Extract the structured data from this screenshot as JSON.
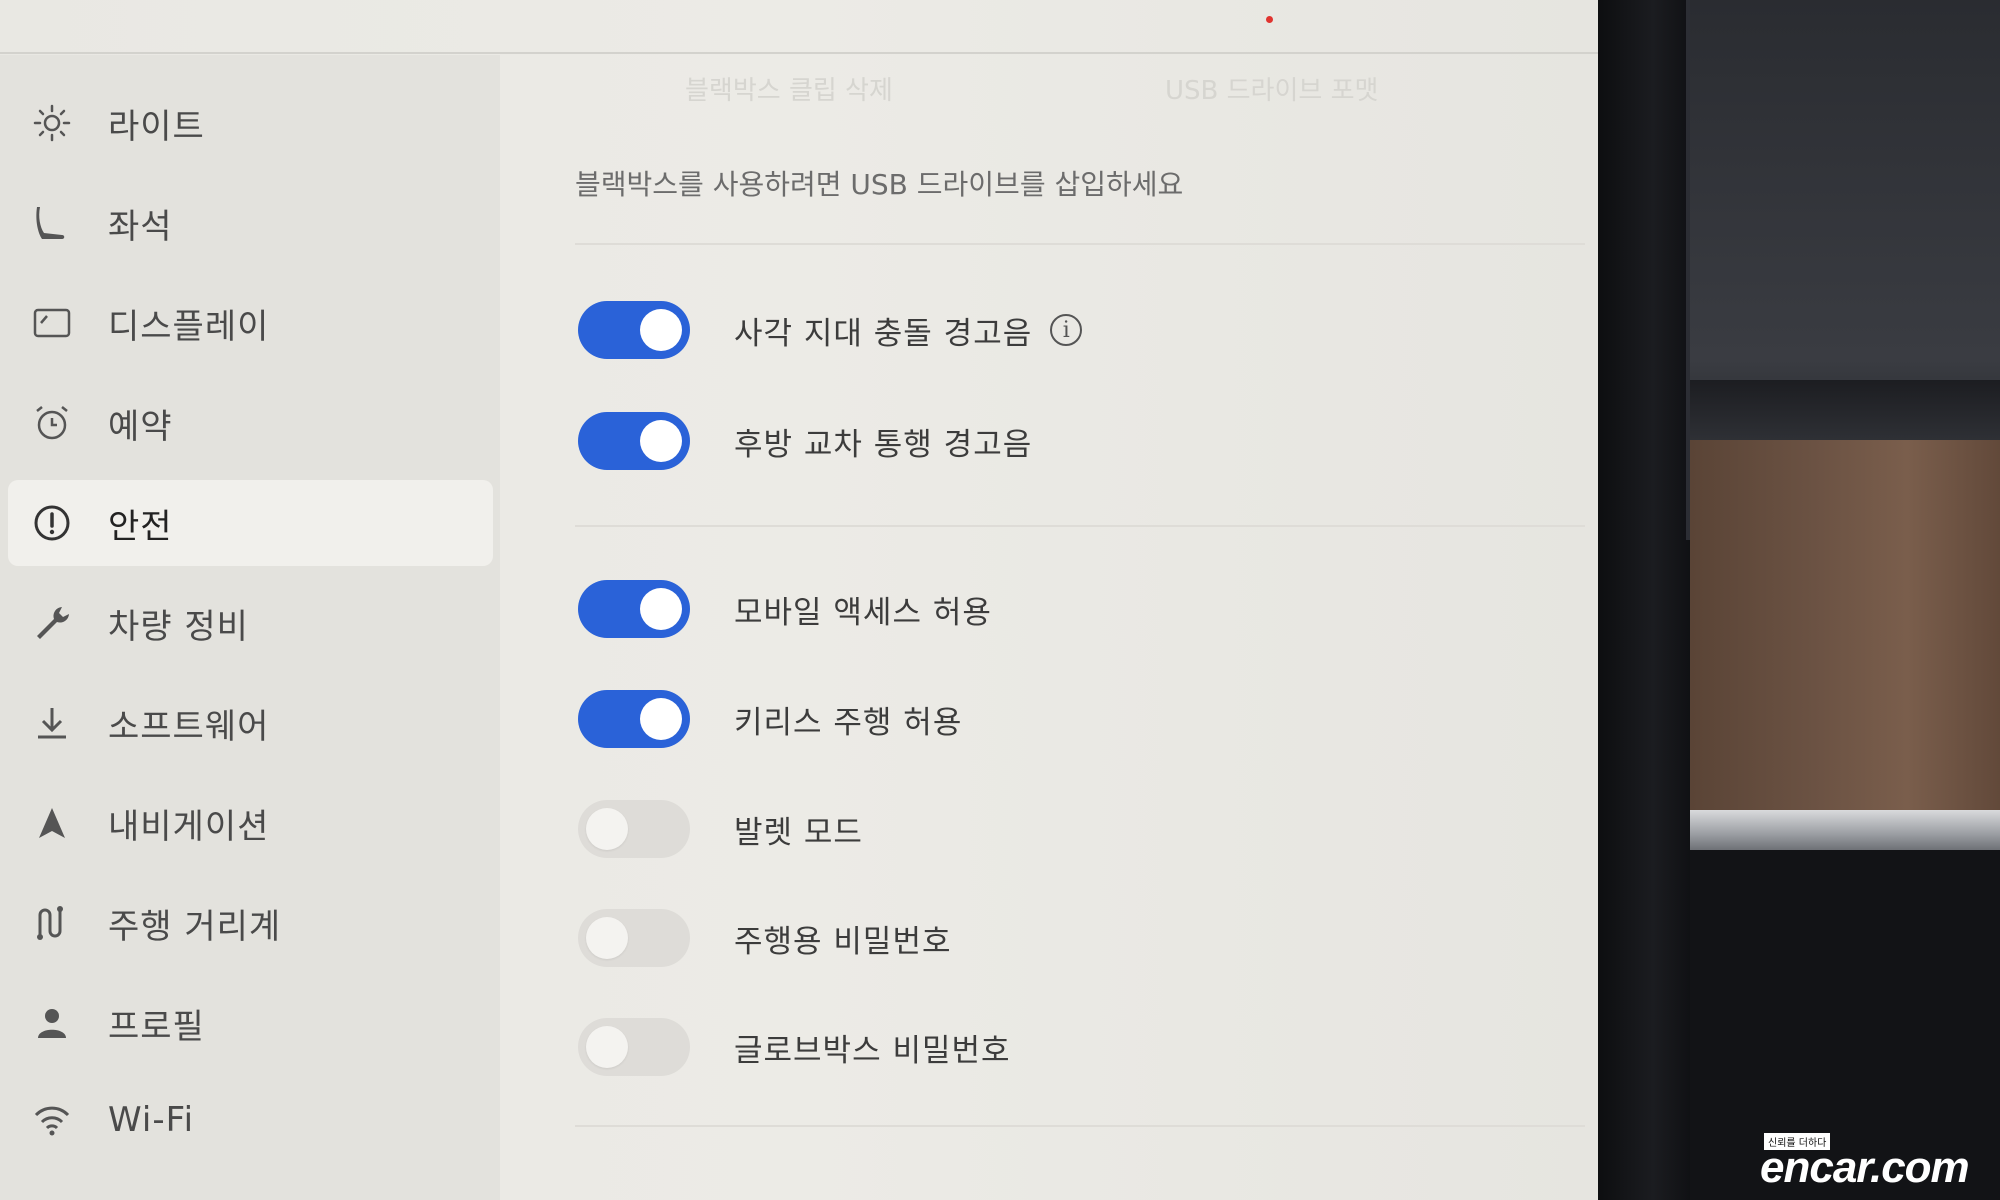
{
  "sidebar": {
    "items": [
      {
        "label": "라이트",
        "icon": "sun-icon"
      },
      {
        "label": "좌석",
        "icon": "seat-icon"
      },
      {
        "label": "디스플레이",
        "icon": "display-icon"
      },
      {
        "label": "예약",
        "icon": "alarm-clock-icon"
      },
      {
        "label": "안전",
        "icon": "alert-circle-icon",
        "active": true
      },
      {
        "label": "차량 정비",
        "icon": "wrench-icon"
      },
      {
        "label": "소프트웨어",
        "icon": "download-icon"
      },
      {
        "label": "내비게이션",
        "icon": "navigation-arrow-icon"
      },
      {
        "label": "주행 거리계",
        "icon": "route-icon"
      },
      {
        "label": "프로필",
        "icon": "person-icon"
      },
      {
        "label": "Wi-Fi",
        "icon": "wifi-icon"
      }
    ]
  },
  "content": {
    "faded_tabs": [
      "블랙박스 클립 삭제",
      "USB 드라이브 포맷"
    ],
    "usb_notice": "블랙박스를 사용하려면 USB 드라이브를 삽입하세요",
    "toggles": [
      {
        "label": "사각 지대 충돌 경고음",
        "on": true,
        "info": true
      },
      {
        "label": "후방 교차 통행 경고음",
        "on": true
      },
      {
        "label": "모바일 액세스 허용",
        "on": true
      },
      {
        "label": "키리스 주행 허용",
        "on": true
      },
      {
        "label": "발렛 모드",
        "on": false
      },
      {
        "label": "주행용 비밀번호",
        "on": false
      },
      {
        "label": "글로브박스 비밀번호",
        "on": false
      }
    ],
    "info_glyph": "i"
  },
  "watermark": {
    "tag": "신뢰를 더하다",
    "text": "encar.com"
  },
  "colors": {
    "toggle_on": "#2a62d8",
    "toggle_off": "#dedcd8",
    "background": "#e9e8e3"
  }
}
